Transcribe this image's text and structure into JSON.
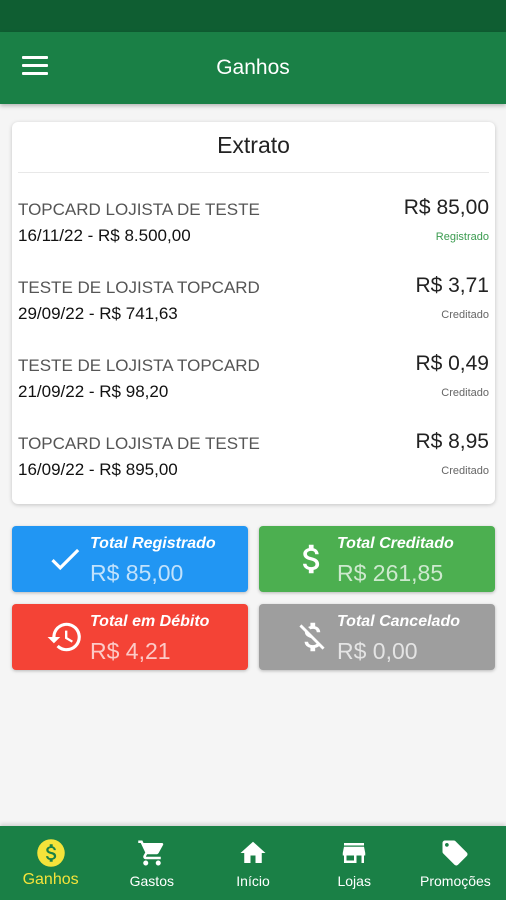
{
  "app_bar": {
    "title": "Ganhos",
    "menu_icon": "menu-icon"
  },
  "statement": {
    "title": "Extrato",
    "rows": [
      {
        "merchant": "TOPCARD LOJISTA DE TESTE",
        "detail": "16/11/22 - R$ 8.500,00",
        "amount": "R$ 85,00",
        "status": "Registrado"
      },
      {
        "merchant": "TESTE DE LOJISTA TOPCARD",
        "detail": "29/09/22 - R$ 741,63",
        "amount": "R$ 3,71",
        "status": "Creditado"
      },
      {
        "merchant": "TESTE DE LOJISTA TOPCARD",
        "detail": "21/09/22 - R$ 98,20",
        "amount": "R$ 0,49",
        "status": "Creditado"
      },
      {
        "merchant": "TOPCARD LOJISTA DE TESTE",
        "detail": "16/09/22 - R$ 895,00",
        "amount": "R$ 8,95",
        "status": "Creditado"
      }
    ]
  },
  "totals": {
    "registrado": {
      "label": "Total Registrado",
      "value": "R$  85,00",
      "color": "#2196f3",
      "icon": "check-icon"
    },
    "creditado": {
      "label": "Total Creditado",
      "value": "R$  261,85",
      "color": "#4caf50",
      "icon": "dollar-icon"
    },
    "debito": {
      "label": "Total em Débito",
      "value": "R$  4,21",
      "color": "#f44336",
      "icon": "history-icon"
    },
    "cancelado": {
      "label": "Total Cancelado",
      "value": "R$ 0,00",
      "color": "#9e9e9e",
      "icon": "money-off-icon"
    }
  },
  "bottom_nav": {
    "items": [
      {
        "label": "Ganhos",
        "icon": "dollar-circle-icon",
        "active": true
      },
      {
        "label": "Gastos",
        "icon": "cart-icon",
        "active": false
      },
      {
        "label": "Início",
        "icon": "home-icon",
        "active": false
      },
      {
        "label": "Lojas",
        "icon": "store-icon",
        "active": false
      },
      {
        "label": "Promoções",
        "icon": "tag-icon",
        "active": false
      }
    ]
  },
  "colors": {
    "primary": "#1a8046",
    "status_bar": "#0f5e32",
    "active_nav": "#f4e33a",
    "registered": "#3a9b4f"
  }
}
